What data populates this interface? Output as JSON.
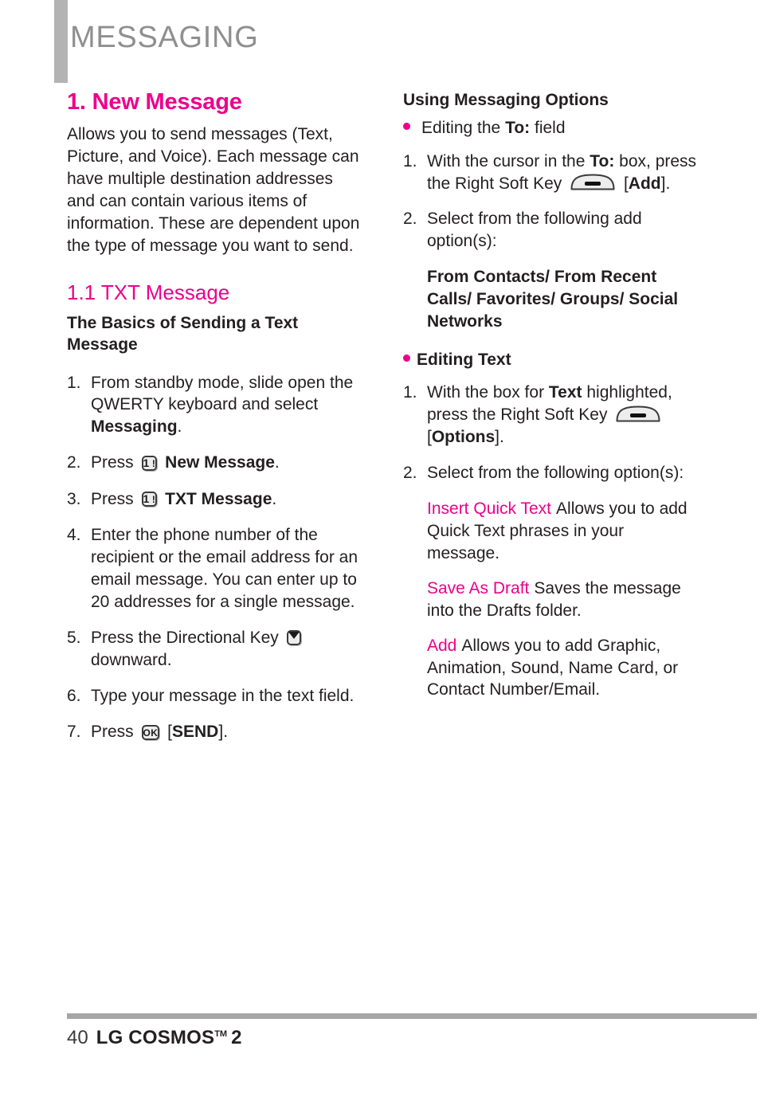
{
  "header": {
    "title": "MESSAGING"
  },
  "colors": {
    "accent": "#ec008c",
    "header_gray": "#8f8f8f",
    "bar_gray": "#b3b3b3"
  },
  "left": {
    "section_title": "1. New Message",
    "intro": "Allows you to send messages (Text, Picture, and Voice). Each message can have multiple destination addresses and can contain various items of information. These are dependent upon the type of message you want to send.",
    "sub_title": "1.1 TXT Message",
    "basics_heading": "The Basics of Sending a Text Message",
    "steps": [
      {
        "num": "1.",
        "pre": "From standby mode, slide open the QWERTY keyboard and select ",
        "bold": "Messaging",
        "post": "."
      },
      {
        "num": "2.",
        "pre": "Press ",
        "icon": "key-1-exclaim",
        "mid": " ",
        "bold": "New Message",
        "post": "."
      },
      {
        "num": "3.",
        "pre": "Press ",
        "icon": "key-1-exclaim",
        "mid": " ",
        "bold": "TXT Message",
        "post": "."
      },
      {
        "num": "4.",
        "pre": "Enter the phone number of the recipient or the email address for an email message. You can enter up to 20 addresses for a single message.",
        "bold": "",
        "post": ""
      },
      {
        "num": "5.",
        "pre": "Press the Directional Key ",
        "icon": "key-direction-down",
        "mid": " ",
        "bold": "",
        "post": "downward."
      },
      {
        "num": "6.",
        "pre": "Type your message in the text field.",
        "bold": "",
        "post": ""
      },
      {
        "num": "7.",
        "pre": "Press ",
        "icon": "key-ok",
        "mid": " [",
        "bold": "SEND",
        "post": "]."
      }
    ]
  },
  "right": {
    "options_heading": "Using Messaging Options",
    "bullet_to_field": {
      "pre": "Editing the ",
      "bold": "To:",
      "post": " field"
    },
    "to_steps": [
      {
        "num": "1.",
        "pre": "With the cursor in the ",
        "bold": "To:",
        "mid": " box, press the Right Soft Key ",
        "icon": "key-soft",
        "post2": " [",
        "bold2": "Add",
        "post3": "]."
      },
      {
        "num": "2.",
        "pre": "Select from the following add option(s):"
      }
    ],
    "add_options": "From Contacts/ From Recent Calls/ Favorites/ Groups/ Social Networks",
    "bullet_editing_text": "Editing Text",
    "text_steps": [
      {
        "num": "1.",
        "pre": "With the box for ",
        "bold": "Text",
        "mid": " highlighted, press the Right Soft Key ",
        "icon": "key-soft",
        "post2": " [",
        "bold2": "Options",
        "post3": "]."
      },
      {
        "num": "2.",
        "pre": "Select from the following option(s):"
      }
    ],
    "text_options": [
      {
        "name": "Insert Quick Text",
        "desc": "Allows you to add Quick Text phrases in your message."
      },
      {
        "name": "Save As Draft",
        "desc": "Saves the message into the Drafts folder."
      },
      {
        "name": "Add",
        "desc": "Allows you to add Graphic, Animation, Sound, Name Card, or Contact Number/Email."
      }
    ]
  },
  "footer": {
    "page_number": "40",
    "product": "LG COSMOS",
    "trademark": "TM",
    "model": "2"
  },
  "icons": {
    "key-1-exclaim": {
      "label": "1 !"
    },
    "key-ok": {
      "label": "OK"
    },
    "key-direction-down": {
      "label": "down-arrow"
    },
    "key-soft": {
      "label": "soft-key-bar"
    }
  }
}
